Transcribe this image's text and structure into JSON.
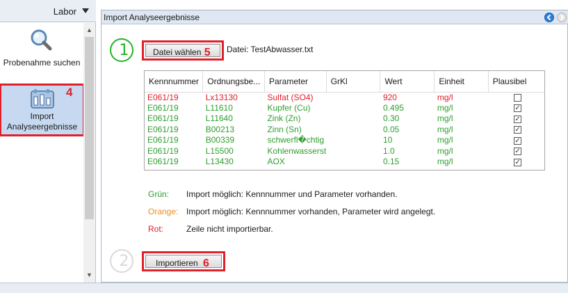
{
  "sidebar": {
    "title": "Labor",
    "items": [
      {
        "label": "Probenahme suchen",
        "icon": "magnifier-icon"
      },
      {
        "label": "Import Analyseergebnisse",
        "icon": "import-lab-icon",
        "step": "4"
      }
    ]
  },
  "main": {
    "title": "Import Analyseergebnisse",
    "step1": "①",
    "step2": "②",
    "choose_button": {
      "label": "Datei wählen",
      "step": "5"
    },
    "file_label": "Datei: TestAbwasser.txt",
    "import_button": {
      "label": "Importieren",
      "step": "6"
    }
  },
  "table": {
    "columns": [
      "Kennnummer",
      "Ordnungsbe...",
      "Parameter",
      "GrKl",
      "Wert",
      "Einheit",
      "Plausibel"
    ],
    "rows": [
      {
        "kennnummer": "E061/19",
        "ordnung": "Lx13130",
        "parameter": "Sulfat (SO4)",
        "grkl": "",
        "wert": "920",
        "einheit": "mg/l",
        "plausibel": false,
        "status": "red"
      },
      {
        "kennnummer": "E061/19",
        "ordnung": "L11610",
        "parameter": "Kupfer (Cu)",
        "grkl": "",
        "wert": "0.495",
        "einheit": "mg/l",
        "plausibel": true,
        "status": "green"
      },
      {
        "kennnummer": "E061/19",
        "ordnung": "L11640",
        "parameter": "Zink (Zn)",
        "grkl": "",
        "wert": "0.30",
        "einheit": "mg/l",
        "plausibel": true,
        "status": "green"
      },
      {
        "kennnummer": "E061/19",
        "ordnung": "B00213",
        "parameter": "Zinn (Sn)",
        "grkl": "",
        "wert": "0.05",
        "einheit": "mg/l",
        "plausibel": true,
        "status": "green"
      },
      {
        "kennnummer": "E061/19",
        "ordnung": "B00339",
        "parameter": "schwerfl�chtig",
        "grkl": "",
        "wert": "10",
        "einheit": "mg/l",
        "plausibel": true,
        "status": "green"
      },
      {
        "kennnummer": "E061/19",
        "ordnung": "L15500",
        "parameter": "Kohlenwasserst",
        "grkl": "",
        "wert": "1.0",
        "einheit": "mg/l",
        "plausibel": true,
        "status": "green"
      },
      {
        "kennnummer": "E061/19",
        "ordnung": "L13430",
        "parameter": "AOX",
        "grkl": "",
        "wert": "0.15",
        "einheit": "mg/l",
        "plausibel": true,
        "status": "green"
      }
    ]
  },
  "legend": [
    {
      "key": "Grün:",
      "text": "Import möglich: Kennnummer und Parameter vorhanden.",
      "color": "#2e9e2e"
    },
    {
      "key": "Orange:",
      "text": "Import möglich: Kennnummer vorhanden, Parameter wird angelegt.",
      "color": "#f08c1a"
    },
    {
      "key": "Rot:",
      "text": "Zeile nicht importierbar.",
      "color": "#e0202a"
    }
  ],
  "colors": {
    "green": "#2e9e2e",
    "red": "#e0202a",
    "orange": "#f08c1a",
    "highlight": "#e0202a",
    "step1_ring": "#22b422"
  }
}
